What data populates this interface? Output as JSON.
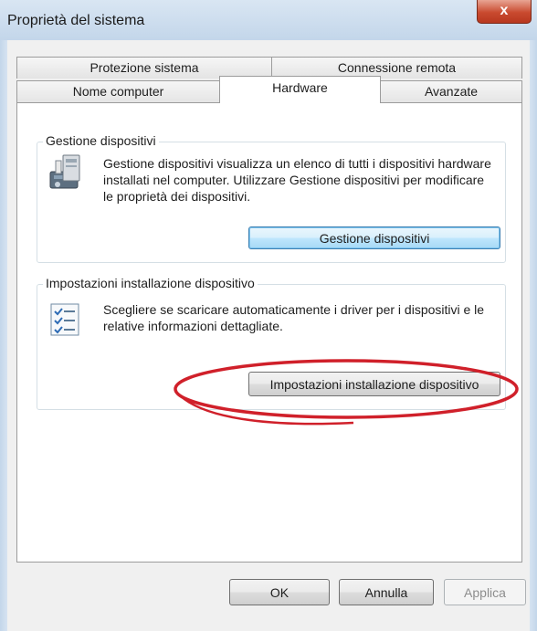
{
  "window": {
    "title": "Proprietà del sistema",
    "close_label": "x"
  },
  "tabs": {
    "row1": [
      {
        "label": "Protezione sistema"
      },
      {
        "label": "Connessione remota"
      }
    ],
    "row2": [
      {
        "label": "Nome computer"
      },
      {
        "label": "Hardware",
        "active": true
      },
      {
        "label": "Avanzate"
      }
    ]
  },
  "device_manager": {
    "group_title": "Gestione dispositivi",
    "description": "Gestione dispositivi visualizza un elenco di tutti i dispositivi hardware installati nel computer. Utilizzare Gestione dispositivi per modificare le proprietà dei dispositivi.",
    "button_label": "Gestione dispositivi",
    "icon": "device-manager-icon"
  },
  "device_installation": {
    "group_title": "Impostazioni installazione dispositivo",
    "description": "Scegliere se scaricare automaticamente i driver per i dispositivi e le relative informazioni dettagliate.",
    "button_label": "Impostazioni installazione dispositivo",
    "icon": "checklist-icon"
  },
  "annotation": {
    "color": "#d0202a"
  },
  "footer": {
    "ok_label": "OK",
    "cancel_label": "Annulla",
    "apply_label": "Applica"
  },
  "colors": {
    "titlebar": "#c3d6ea",
    "close": "#c94a2f",
    "focus_button": "#bee6fd"
  }
}
